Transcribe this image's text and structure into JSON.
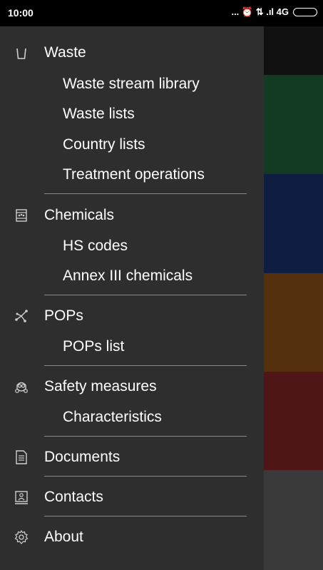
{
  "status_bar": {
    "time": "10:00",
    "indicators": "... ⏰ ⇅ .ıl 4G",
    "battery_icon": "battery-icon"
  },
  "background_tiles": [
    {
      "name": "tile-black",
      "color": "#111111"
    },
    {
      "name": "tile-green",
      "color": "#133a23"
    },
    {
      "name": "tile-blue",
      "color": "#0f1e40"
    },
    {
      "name": "tile-orange",
      "color": "#55300f"
    },
    {
      "name": "tile-red",
      "color": "#4e1617"
    },
    {
      "name": "tile-grey",
      "color": "#3a3a3a"
    }
  ],
  "drawer": {
    "sections": [
      {
        "label": "Waste",
        "icon": "waste-bin-icon",
        "items": [
          "Waste stream library",
          "Waste lists",
          "Country lists",
          "Treatment operations"
        ]
      },
      {
        "label": "Chemicals",
        "icon": "chemical-drum-icon",
        "items": [
          "HS codes",
          "Annex III chemicals"
        ]
      },
      {
        "label": "POPs",
        "icon": "molecule-icon",
        "items": [
          "POPs list"
        ]
      },
      {
        "label": "Safety measures",
        "icon": "gas-mask-icon",
        "items": [
          "Characteristics"
        ]
      },
      {
        "label": "Documents",
        "icon": "document-icon",
        "items": []
      },
      {
        "label": "Contacts",
        "icon": "contact-card-icon",
        "items": []
      },
      {
        "label": "About",
        "icon": "gear-icon",
        "items": []
      }
    ]
  }
}
